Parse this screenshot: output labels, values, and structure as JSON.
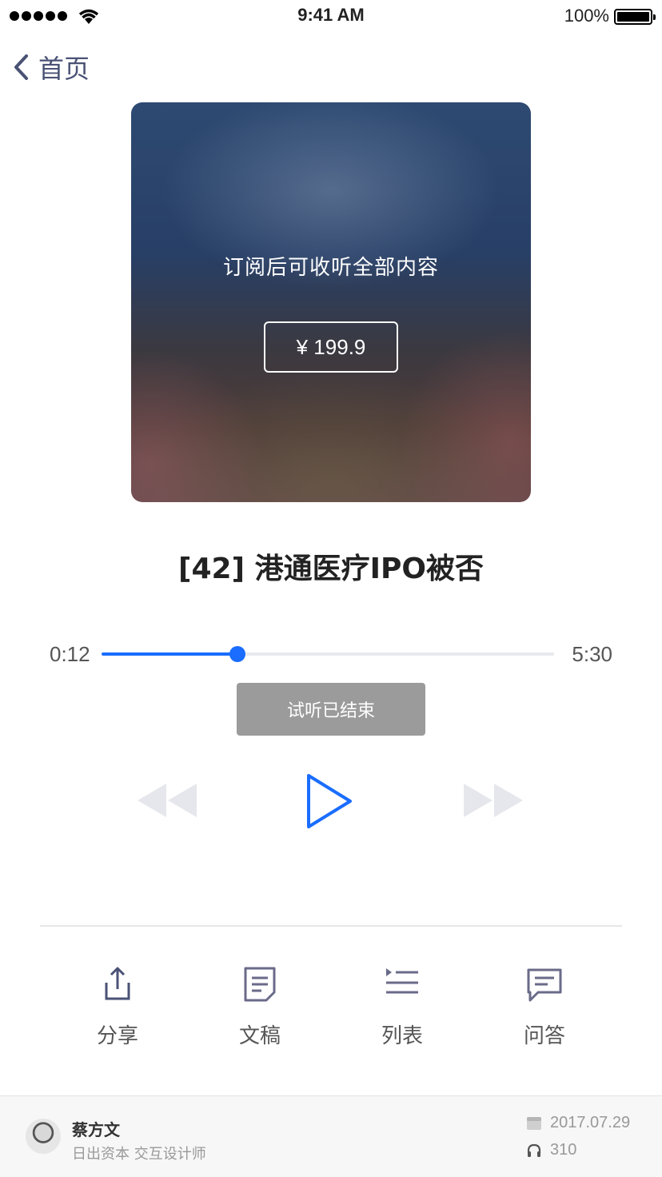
{
  "status_bar": {
    "time": "9:41 AM",
    "battery": "100%"
  },
  "nav": {
    "back_label": "首页"
  },
  "cover": {
    "subscribe_prompt": "订阅后可收听全部内容",
    "price": "¥ 199.9"
  },
  "episode": {
    "title": "[42] 港通医疗IPO被否"
  },
  "player": {
    "elapsed": "0:12",
    "total": "5:30",
    "progress": 0.3,
    "trial_status": "试听已结束"
  },
  "actions": [
    {
      "label": "分享",
      "icon": "share-icon"
    },
    {
      "label": "文稿",
      "icon": "document-icon"
    },
    {
      "label": "列表",
      "icon": "list-icon"
    },
    {
      "label": "问答",
      "icon": "qa-icon"
    }
  ],
  "footer": {
    "author_name": "蔡方文",
    "author_desc": "日出资本 交互设计师",
    "date": "2017.07.29",
    "plays": "310"
  },
  "colors": {
    "accent": "#1a6dff",
    "nav_text": "#4a5275",
    "icon": "#6a6a8a",
    "disabled_control": "#e6e7ec"
  }
}
